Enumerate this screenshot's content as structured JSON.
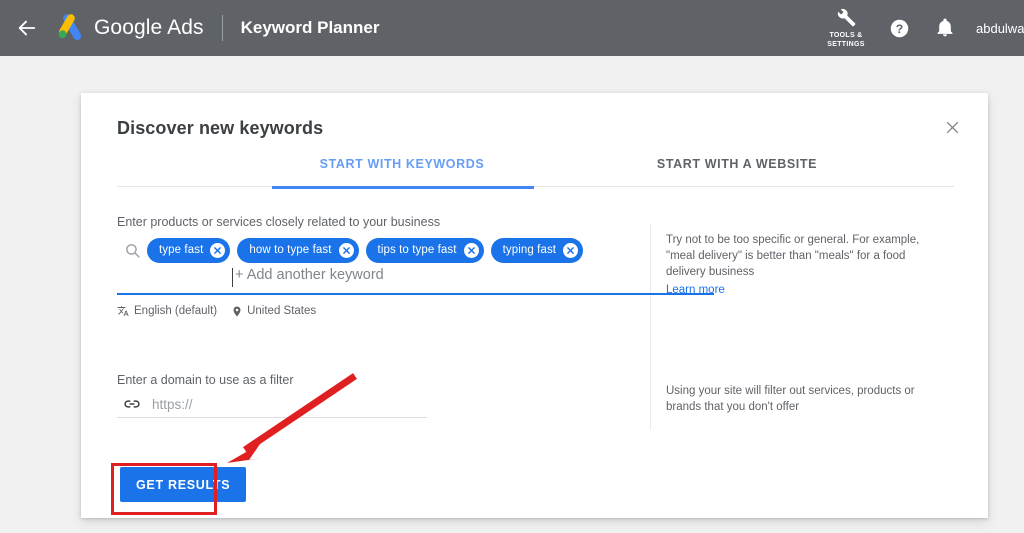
{
  "topbar": {
    "back_icon": "back-arrow-icon",
    "logo_icon": "google-ads-logo-icon",
    "brand": "Google Ads",
    "page_title": "Keyword Planner",
    "tools_icon": "wrench-icon",
    "tools_label": "TOOLS &\nSETTINGS",
    "tools_label_line1": "Tools &",
    "tools_label_line2": "Settings",
    "help_icon": "help-circle-icon",
    "notifications_icon": "bell-icon",
    "user_name": "abdulwa",
    "background_color": "#5f6368"
  },
  "dialog": {
    "title": "Discover new keywords",
    "close_icon": "close-icon",
    "tabs": [
      {
        "label": "START WITH KEYWORDS",
        "active": true
      },
      {
        "label": "START WITH A WEBSITE",
        "active": false
      }
    ],
    "active_tab_color": "#4285f4"
  },
  "keywords_section": {
    "label": "Enter products or services closely related to your business",
    "search_icon": "search-icon",
    "chips": [
      {
        "text": "type fast",
        "remove_icon": "chip-close-icon"
      },
      {
        "text": "how to type fast",
        "remove_icon": "chip-close-icon"
      },
      {
        "text": "tips to type fast",
        "remove_icon": "chip-close-icon"
      },
      {
        "text": "typing fast",
        "remove_icon": "chip-close-icon"
      }
    ],
    "chip_color": "#1a73e8",
    "input_placeholder": "+ Add another keyword",
    "language": {
      "icon": "translate-icon",
      "label": "English (default)"
    },
    "location": {
      "icon": "location-pin-icon",
      "label": "United States"
    },
    "hint": "Try not to be too specific or general. For example, \"meal delivery\" is better than \"meals\" for a food delivery business",
    "learn_more": "Learn more"
  },
  "domain_section": {
    "label": "Enter a domain to use as a filter",
    "link_icon": "link-icon",
    "input_placeholder": "https://",
    "input_value": "",
    "hint": "Using your site will filter out services, products or brands that you don't offer"
  },
  "actions": {
    "get_results": "GET RESULTS",
    "get_results_color": "#1a73e8"
  },
  "annotations": {
    "highlight_color": "#e02020",
    "box_target": "get-results-button",
    "arrow_target": "get-results-button"
  }
}
